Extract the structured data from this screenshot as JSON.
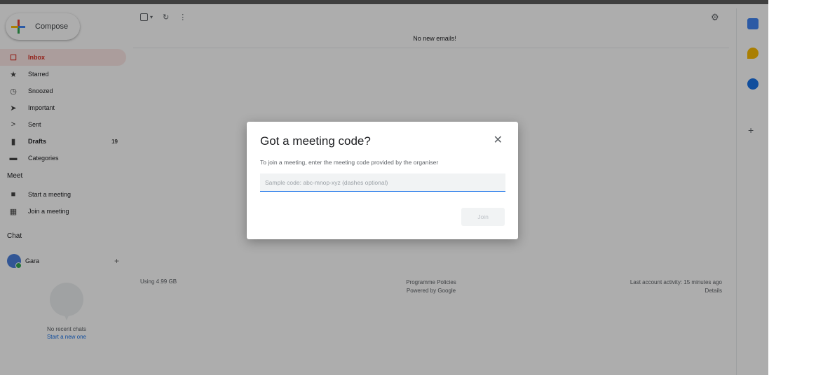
{
  "sidebar": {
    "compose_label": "Compose",
    "items": [
      {
        "label": "Inbox",
        "icon": "inbox-icon",
        "glyph": "☐",
        "count": ""
      },
      {
        "label": "Starred",
        "icon": "star-icon",
        "glyph": "★",
        "count": ""
      },
      {
        "label": "Snoozed",
        "icon": "clock-icon",
        "glyph": "◷",
        "count": ""
      },
      {
        "label": "Important",
        "icon": "important-icon",
        "glyph": "➤",
        "count": ""
      },
      {
        "label": "Sent",
        "icon": "sent-icon",
        "glyph": ">",
        "count": ""
      },
      {
        "label": "Drafts",
        "icon": "draft-icon",
        "glyph": "▮",
        "count": "19"
      },
      {
        "label": "Categories",
        "icon": "label-icon",
        "glyph": "▬",
        "count": ""
      }
    ],
    "meet": {
      "heading": "Meet",
      "start": "Start a meeting",
      "join": "Join a meeting"
    },
    "chat": {
      "heading": "Chat",
      "user": "Gara",
      "add": "+",
      "no_chats": "No recent chats",
      "start_new": "Start a new one"
    }
  },
  "main": {
    "no_new_emails": "No new emails!",
    "footer": {
      "storage": "Using 4.99 GB",
      "policies": "Programme Policies",
      "powered": "Powered by Google",
      "activity": "Last account activity: 15 minutes ago",
      "details": "Details"
    }
  },
  "dialog": {
    "title": "Got a meeting code?",
    "description": "To join a meeting, enter the meeting code provided by the organiser",
    "input_placeholder": "Sample code: abc-mnop-xyz (dashes optional)",
    "input_value": "",
    "join_label": "Join",
    "close_glyph": "✕"
  },
  "colors": {
    "accent_blue": "#1a73e8",
    "inbox_red": "#d93025",
    "scrim": "rgba(0,0,0,0.32)"
  }
}
